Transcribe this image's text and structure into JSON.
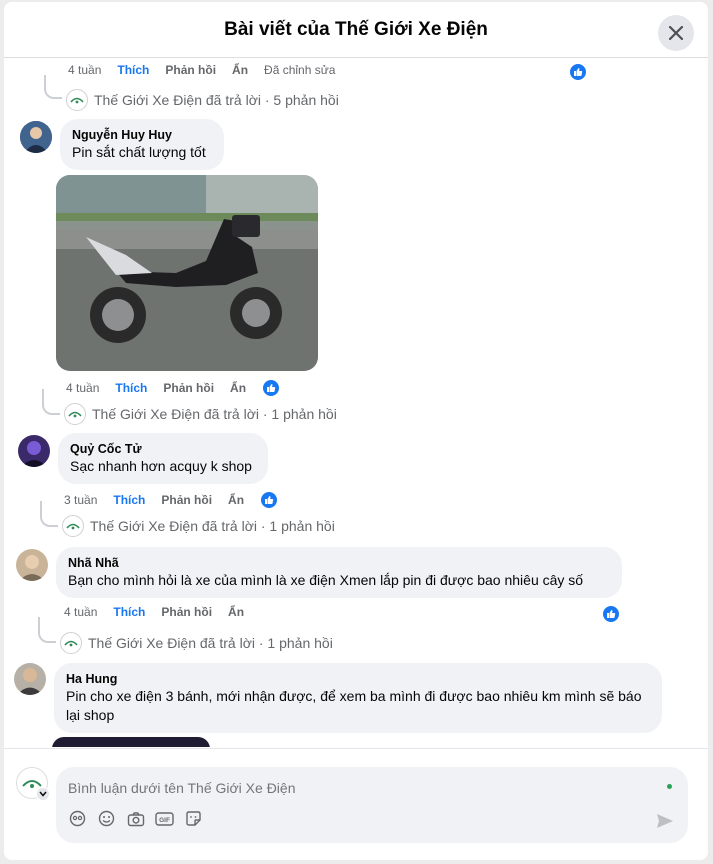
{
  "header": {
    "title": "Bài viết của Thế Giới Xe Điện"
  },
  "colors": {
    "accent": "#1877f2",
    "bubble": "#f0f2f5",
    "secondary_text": "#65676b"
  },
  "top_meta": {
    "time": "4 tuần",
    "like": "Thích",
    "reply": "Phản hồi",
    "hide": "Ẩn",
    "edited": "Đã chỉnh sửa"
  },
  "comments": [
    {
      "author": "Nguyễn Huy Huy",
      "text": "Pin sắt chất lượng tốt",
      "time": "4 tuần",
      "like": "Thích",
      "reply": "Phản hồi",
      "hide": "Ẩn",
      "has_photo": true,
      "photo_label": "electric-scooter-photo"
    },
    {
      "author": "Quỷ Cốc Tử",
      "text": "Sạc nhanh hơn acquy k shop",
      "time": "3 tuần",
      "like": "Thích",
      "reply": "Phản hồi",
      "hide": "Ẩn"
    },
    {
      "author": "Nhã Nhã",
      "text": "Bạn cho mình hỏi là xe của mình là xe điện Xmen lắp pin đi được bao nhiêu cây số",
      "time": "4 tuần",
      "like": "Thích",
      "reply": "Phản hồi",
      "hide": "Ẩn"
    },
    {
      "author": "Ha Hung",
      "text": "Pin cho xe điện 3 bánh, mới nhận được, để xem ba mình đi được bao nhiêu km mình sẽ báo lại shop"
    }
  ],
  "replies": [
    "Thế Giới Xe Điện đã trả lời · 5 phản hồi",
    "Thế Giới Xe Điện đã trả lời · 1 phản hồi",
    "Thế Giới Xe Điện đã trả lời · 1 phản hồi",
    "Thế Giới Xe Điện đã trả lời · 1 phản hồi"
  ],
  "composer": {
    "placeholder": "Bình luận dưới tên Thế Giới Xe Điện"
  },
  "icons": [
    "close-icon",
    "like-reaction-icon",
    "page-logo-icon",
    "avatar-icon",
    "photo-icon",
    "emoji-icon",
    "camera-icon",
    "gif-icon",
    "sticker-icon",
    "send-icon",
    "chevron-down-icon"
  ]
}
